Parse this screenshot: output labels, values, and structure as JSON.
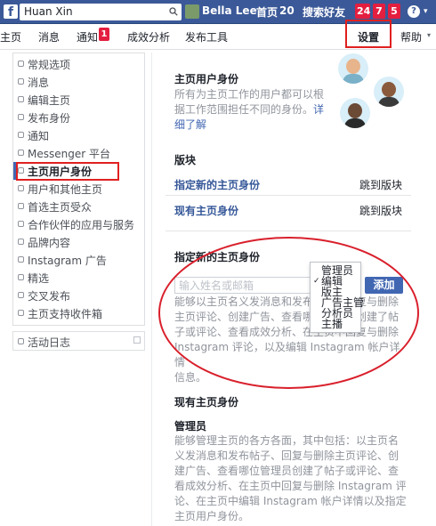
{
  "topbar": {
    "logo": "f",
    "search_value": "Huan  Xin",
    "user_name": "Bella Lee",
    "home_label": "首页",
    "home_count": "20",
    "find_friends": "搜索好友",
    "badge_friends": "24",
    "badge_messages": "7",
    "badge_notifications": "5",
    "help_label": "?",
    "caret": "▾"
  },
  "page_tabs": {
    "page": "主页",
    "messages": "消息",
    "notifications": "通知",
    "notifications_count": "1",
    "insights": "成效分析",
    "publishing_tools": "发布工具",
    "settings": "设置",
    "help": "帮助",
    "caret": "▾"
  },
  "sidebar": {
    "items": [
      {
        "label": "常规选项"
      },
      {
        "label": "消息"
      },
      {
        "label": "编辑主页"
      },
      {
        "label": "发布身份"
      },
      {
        "label": "通知"
      },
      {
        "label": "Messenger 平台"
      },
      {
        "label": "主页用户身份"
      },
      {
        "label": "用户和其他主页"
      },
      {
        "label": "首选主页受众"
      },
      {
        "label": "合作伙伴的应用与服务"
      },
      {
        "label": "品牌内容"
      },
      {
        "label": "Instagram 广告"
      },
      {
        "label": "精选"
      },
      {
        "label": "交叉发布"
      },
      {
        "label": "主页支持收件箱"
      }
    ],
    "activity_log": "活动日志"
  },
  "main": {
    "page_roles_title": "主页用户身份",
    "page_roles_desc_1": "所有为主页工作的用户都可以根",
    "page_roles_desc_2": "据工作范围担任不同的身份。",
    "learn_more_1": "详",
    "learn_more_2": "细了解",
    "section_title": "版块",
    "assign_new_role": "指定新的主页身份",
    "jump_to_section_1": "跳到版块",
    "existing_roles": "现有主页身份",
    "jump_to_section_2": "跳到版块",
    "assign_title": "指定新的主页身份",
    "name_input_placeholder": "输入姓名或邮箱",
    "add_button": "添加",
    "assign_desc_1": "能够以主页名义发消息和发布帖子、回复与删除",
    "assign_desc_2": "主页评论、创建广告、查看哪位管理员创建了帖",
    "assign_desc_3": "子或评论、查看成效分析、在主页中回复与删除",
    "assign_desc_4": "Instagram 评论，以及编辑 Instagram 帐户详情",
    "assign_desc_5": "信息。",
    "role_options": [
      "管理员",
      "编辑",
      "版主",
      "广告主管",
      "分析员",
      "主播"
    ],
    "role_selected": "编辑",
    "existing_title": "现有主页身份",
    "admin_title": "管理员",
    "admin_desc_1": "能够管理主页的各方各面，其中包括：以主页名",
    "admin_desc_2": "义发消息和发布帖子、回复与删除主页评论、创",
    "admin_desc_3": "建广告、查看哪位管理员创建了帖子或评论、查",
    "admin_desc_4": "看成效分析、在主页中回复与删除 Instagram 评",
    "admin_desc_5": "论、在主页中编辑 Instagram 帐户详情以及指定",
    "admin_desc_6": "主页用户身份。"
  },
  "colors": {
    "fb_blue": "#3b5998",
    "button_blue": "#4267b2",
    "annotation_red": "#e02020",
    "badge_red": "#e41e3f"
  }
}
